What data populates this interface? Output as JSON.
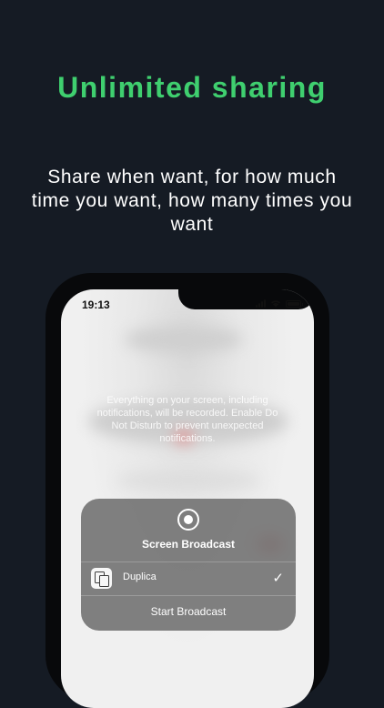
{
  "headline": "Unlimited sharing",
  "subtitle": "Share when want, for how much time you want, how many times you want",
  "colors": {
    "background": "#151b24",
    "accent": "#3fcf6f",
    "sheet": "#6c6c6c"
  },
  "phone": {
    "status_time": "19:13",
    "warning_text": "Everything on your screen, including notifications, will be recorded. Enable Do Not Disturb to prevent unexpected notifications.",
    "broadcast_sheet": {
      "icon": "record-icon",
      "title": "Screen Broadcast",
      "app_name": "Duplica",
      "app_icon": "duplica-app-icon",
      "selected_mark": "✓",
      "start_button": "Start Broadcast"
    }
  }
}
